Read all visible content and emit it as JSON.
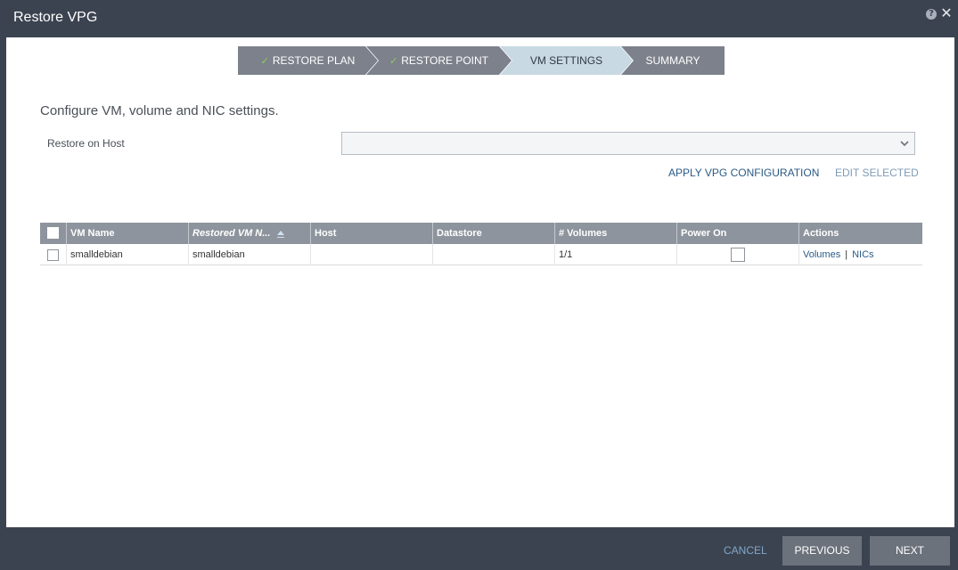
{
  "window": {
    "title": "Restore VPG",
    "help_icon": "question-mark-icon",
    "close_icon": "close-icon"
  },
  "wizard": {
    "steps": [
      {
        "label": "RESTORE PLAN",
        "completed": true,
        "active": false
      },
      {
        "label": "RESTORE POINT",
        "completed": true,
        "active": false
      },
      {
        "label": "VM SETTINGS",
        "completed": false,
        "active": true
      },
      {
        "label": "SUMMARY",
        "completed": false,
        "active": false
      }
    ],
    "check_glyph": "✓"
  },
  "main": {
    "heading": "Configure VM, volume and NIC settings.",
    "host_label": "Restore on Host",
    "host_value": "",
    "apply_label": "APPLY VPG CONFIGURATION",
    "edit_label": "EDIT SELECTED"
  },
  "table": {
    "columns": [
      "VM Name",
      "Restored VM N...",
      "Host",
      "Datastore",
      "# Volumes",
      "Power On",
      "Actions"
    ],
    "sorted_column": "Restored VM N...",
    "rows": [
      {
        "selected": false,
        "vm_name": "smalldebian",
        "restored_vm_name": "smalldebian",
        "host": "",
        "datastore": "",
        "volumes": "1/1",
        "power_on": false,
        "actions": [
          "Volumes",
          "NICs"
        ]
      }
    ],
    "action_separator": "|"
  },
  "footer": {
    "cancel_label": "CANCEL",
    "previous_label": "PREVIOUS",
    "next_label": "NEXT"
  },
  "colors": {
    "chrome": "#3c4350",
    "step_done": "#7c818b",
    "step_active": "#c8d9e3",
    "link": "#2a5a85",
    "check": "#8fd14f"
  }
}
